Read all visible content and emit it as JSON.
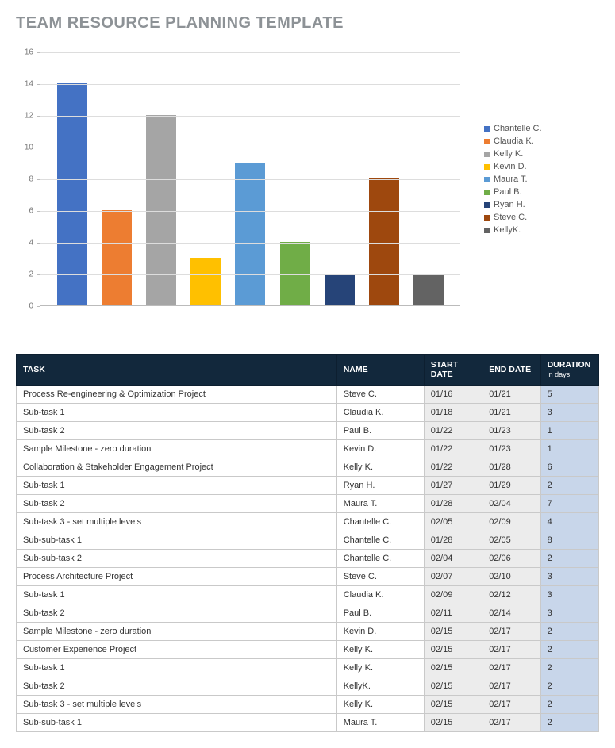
{
  "title": "TEAM RESOURCE PLANNING TEMPLATE",
  "chart_data": {
    "type": "bar",
    "categories": [
      "Chantelle C.",
      "Claudia K.",
      "Kelly K.",
      "Kevin D.",
      "Maura T.",
      "Paul B.",
      "Ryan H.",
      "Steve C.",
      "KellyK."
    ],
    "values": [
      14,
      6,
      12,
      3,
      9,
      4,
      2,
      8,
      2
    ],
    "colors": [
      "#4472c4",
      "#ed7d31",
      "#a5a5a5",
      "#ffc000",
      "#5b9bd5",
      "#70ad47",
      "#264478",
      "#9e480e",
      "#636363"
    ],
    "title": "",
    "xlabel": "",
    "ylabel": "",
    "ylim": [
      0,
      16
    ],
    "ystep": 2
  },
  "table": {
    "headers": {
      "task": "TASK",
      "name": "NAME",
      "start": "START DATE",
      "end": "END DATE",
      "duration": "DURATION",
      "duration_sub": "in days"
    },
    "rows": [
      {
        "task": "Process Re-engineering & Optimization Project",
        "name": "Steve C.",
        "start": "01/16",
        "end": "01/21",
        "dur": "5"
      },
      {
        "task": "Sub-task 1",
        "name": "Claudia K.",
        "start": "01/18",
        "end": "01/21",
        "dur": "3"
      },
      {
        "task": "Sub-task 2",
        "name": "Paul B.",
        "start": "01/22",
        "end": "01/23",
        "dur": "1"
      },
      {
        "task": "Sample Milestone - zero duration",
        "name": "Kevin D.",
        "start": "01/22",
        "end": "01/23",
        "dur": "1"
      },
      {
        "task": "Collaboration & Stakeholder Engagement Project",
        "name": "Kelly K.",
        "start": "01/22",
        "end": "01/28",
        "dur": "6"
      },
      {
        "task": "Sub-task 1",
        "name": "Ryan H.",
        "start": "01/27",
        "end": "01/29",
        "dur": "2"
      },
      {
        "task": "Sub-task 2",
        "name": "Maura T.",
        "start": "01/28",
        "end": "02/04",
        "dur": "7"
      },
      {
        "task": "Sub-task 3 - set multiple levels",
        "name": "Chantelle C.",
        "start": "02/05",
        "end": "02/09",
        "dur": "4"
      },
      {
        "task": "Sub-sub-task 1",
        "name": "Chantelle C.",
        "start": "01/28",
        "end": "02/05",
        "dur": "8"
      },
      {
        "task": "Sub-sub-task 2",
        "name": "Chantelle C.",
        "start": "02/04",
        "end": "02/06",
        "dur": "2"
      },
      {
        "task": "Process Architecture Project",
        "name": "Steve C.",
        "start": "02/07",
        "end": "02/10",
        "dur": "3"
      },
      {
        "task": "Sub-task 1",
        "name": "Claudia K.",
        "start": "02/09",
        "end": "02/12",
        "dur": "3"
      },
      {
        "task": "Sub-task 2",
        "name": "Paul B.",
        "start": "02/11",
        "end": "02/14",
        "dur": "3"
      },
      {
        "task": "Sample Milestone - zero duration",
        "name": "Kevin D.",
        "start": "02/15",
        "end": "02/17",
        "dur": "2"
      },
      {
        "task": "Customer Experience Project",
        "name": "Kelly K.",
        "start": "02/15",
        "end": "02/17",
        "dur": "2"
      },
      {
        "task": "Sub-task 1",
        "name": "Kelly K.",
        "start": "02/15",
        "end": "02/17",
        "dur": "2"
      },
      {
        "task": "Sub-task 2",
        "name": "KellyK.",
        "start": "02/15",
        "end": "02/17",
        "dur": "2"
      },
      {
        "task": "Sub-task 3 - set multiple levels",
        "name": "Kelly K.",
        "start": "02/15",
        "end": "02/17",
        "dur": "2"
      },
      {
        "task": "Sub-sub-task 1",
        "name": "Maura T.",
        "start": "02/15",
        "end": "02/17",
        "dur": "2"
      }
    ]
  }
}
